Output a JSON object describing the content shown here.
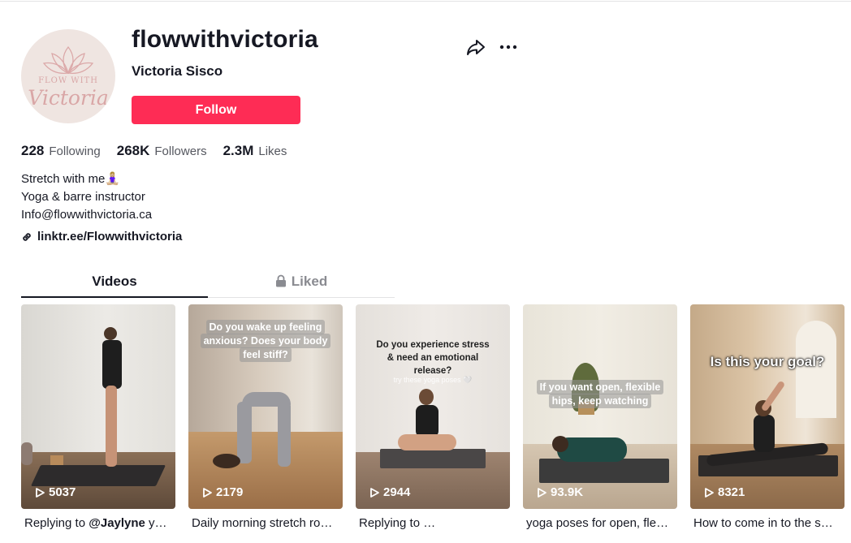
{
  "profile": {
    "avatar_line1": "FLOW WITH",
    "avatar_line2": "Victoria",
    "username": "flowwithvictoria",
    "nickname": "Victoria Sisco",
    "follow_label": "Follow"
  },
  "stats": {
    "following_count": "228",
    "following_label": "Following",
    "followers_count": "268K",
    "followers_label": "Followers",
    "likes_count": "2.3M",
    "likes_label": "Likes"
  },
  "bio": {
    "line1": "Stretch with me🧘🏼‍♀️",
    "line2": "Yoga & barre instructor",
    "line3": "Info@flowwithvictoria.ca"
  },
  "link": {
    "label": "linktr.ee/Flowwithvictoria",
    "icon": "link-icon"
  },
  "tabs": {
    "videos": "Videos",
    "liked": "Liked"
  },
  "icons": {
    "share": "share-icon",
    "more": "more-icon",
    "lock": "lock-icon",
    "play": "play-icon"
  },
  "colors": {
    "accent": "#fe2c55",
    "text": "#161823",
    "secondary": "#8a8b91"
  },
  "videos": [
    {
      "views": "5037",
      "caption_prefix": "Replying to ",
      "caption_mention": "@Jaylyne",
      "caption_suffix": " y…",
      "overlay": ""
    },
    {
      "views": "2179",
      "caption": "Daily morning stretch ro…",
      "overlay": "Do you wake up feeling anxious? Does your body feel stiff?"
    },
    {
      "views": "2944",
      "caption": "Replying to …",
      "overlay": "Do you experience stress & need an emotional release?",
      "overlay_sub": "try these yoga poses 🤍"
    },
    {
      "views": "93.9K",
      "caption": "yoga poses for open, fle…",
      "overlay": "If you want open, flexible hips, keep watching"
    },
    {
      "views": "8321",
      "caption": "How to come in to the s…",
      "overlay": "Is this your goal?"
    }
  ]
}
